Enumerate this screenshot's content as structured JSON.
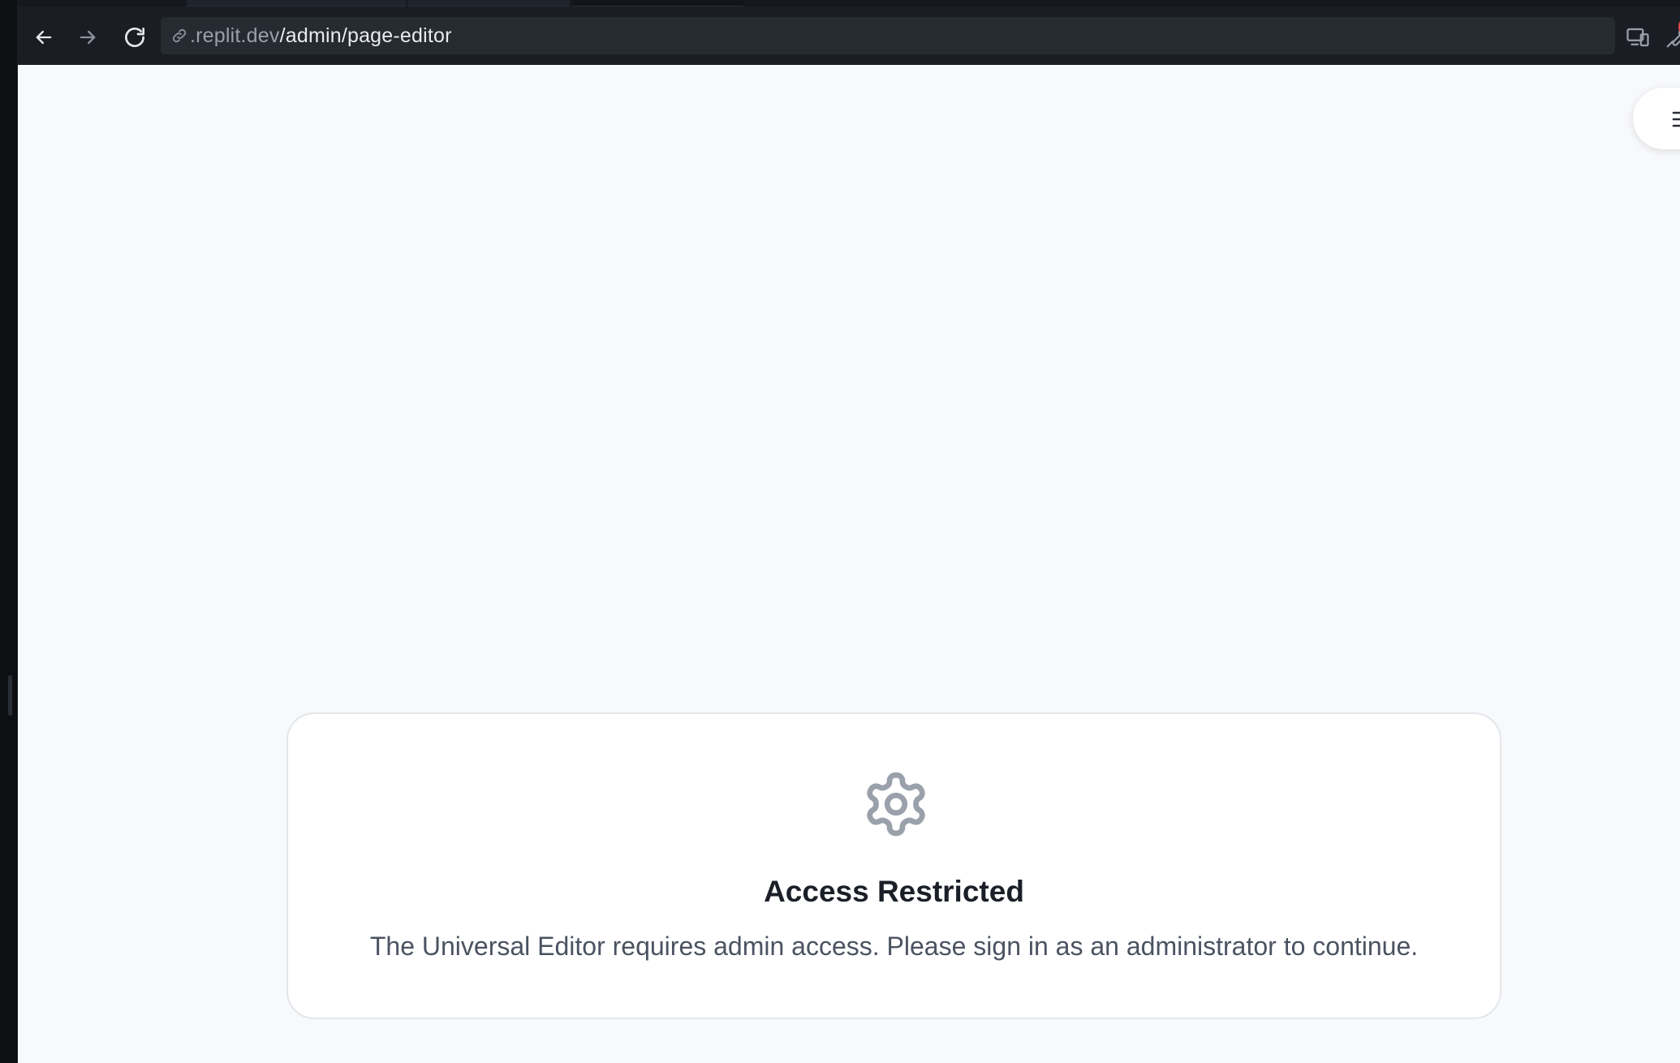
{
  "browser": {
    "url_host": ".replit.dev",
    "url_path": "/admin/page-editor",
    "notification_count": "1"
  },
  "icons": {
    "back": "arrow-left-icon",
    "forward": "arrow-right-icon",
    "reload": "refresh-icon",
    "link": "link-icon",
    "devices": "responsive-devices-icon",
    "tools": "wrench-icon",
    "menu": "menu-bars-icon",
    "settings": "gear-icon"
  },
  "colors": {
    "chrome_bg": "#1a1d23",
    "page_bg": "#f8f9fb",
    "badge": "#e5484d",
    "gear": "#9ba1ab"
  },
  "restricted": {
    "title": "Access Restricted",
    "message": "The Universal Editor requires admin access. Please sign in as an administrator to continue."
  }
}
